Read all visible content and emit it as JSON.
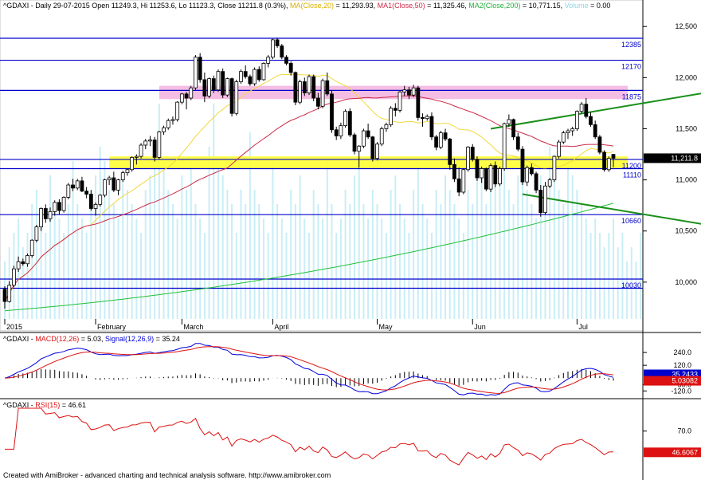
{
  "colors": {
    "background": "#ffffff",
    "up_candle": "#ffffff",
    "down_candle": "#000000",
    "ma20": "#f2d83c",
    "ma50": "#cc2b4a",
    "ma200": "#22c03a",
    "volume": "#c9eef6",
    "hline": "#0000cc",
    "zone_yellow": "#ffff33",
    "zone_pink": "#f4b6e0",
    "channel": "#1a8f1a",
    "macd": "#0000dd",
    "signal": "#dd1111",
    "rsi": "#dd1111",
    "price_badge": "#000000",
    "macd_badge": "#0000cc",
    "signal_badge": "#dd1111",
    "rsi_badge": "#dd1111"
  },
  "header": {
    "symbol_line": "^GDAXI - Daily 29-07-2015 Open 11249.3, Hi 11253.6, Lo 11123.3, Close 11211.8 (0.3%)",
    "ma20_label": "MA(Close,20)",
    "ma20_value": " = 11,293.93, ",
    "ma50_label": "MA1(Close,50)",
    "ma50_value": " = 11,325.46, ",
    "ma200_label": "MA2(Close,200)",
    "ma200_value": " = 10,771.15, ",
    "volume_label": "Volume",
    "volume_value": " = 0.00"
  },
  "macd_header": {
    "prefix": "^GDAXI - ",
    "macd_label": "MACD(12,26)",
    "macd_value": " = 5.03, ",
    "signal_label": "Signal(12,26,9)",
    "signal_value": " = 35.24"
  },
  "rsi_header": {
    "prefix": "^GDAXI - ",
    "rsi_label": "RSI(15)",
    "rsi_value": " = 46.61"
  },
  "footer": "Created with AmiBroker - advanced charting and technical analysis software. http://www.amibroker.com",
  "price_axis_ticks": [
    "12,500",
    "12,000",
    "11,500",
    "11,000",
    "10,500",
    "10,000"
  ],
  "macd_axis_ticks": [
    "240.0",
    "120.0",
    "-60.0",
    "-120.0"
  ],
  "rsi_axis_ticks": [
    "70.0"
  ],
  "badges": {
    "price": "11,211.8",
    "macd": "35.2433",
    "signal": "5.03082",
    "rsi": "46.6067"
  },
  "chart_data": {
    "type": "candlestick",
    "x_axis_labels": [
      "2015",
      "February",
      "March",
      "April",
      "May",
      "Jun",
      "Jul"
    ],
    "ylim": [
      9640,
      12650
    ],
    "horizontal_levels": [
      {
        "value": 12385,
        "label": "12385"
      },
      {
        "value": 12170,
        "label": "12170"
      },
      {
        "value": 11875,
        "label": "11875"
      },
      {
        "value": 11200,
        "label": "11200"
      },
      {
        "value": 11110,
        "label": "11110"
      },
      {
        "value": 10660,
        "label": "10660"
      },
      {
        "value": 10030,
        "label": "10030"
      },
      {
        "value": 9940,
        "label": ""
      }
    ],
    "zones": [
      {
        "name": "yellow",
        "from": 11110,
        "to": 11230
      },
      {
        "name": "pink",
        "from": 11790,
        "to": 11920
      }
    ],
    "channel_lines": [
      {
        "from": {
          "i": 107,
          "v": 11500
        },
        "to": {
          "i": 162,
          "v": 11910
        }
      },
      {
        "from": {
          "i": 114,
          "v": 10860
        },
        "to": {
          "i": 156,
          "v": 10550
        }
      }
    ],
    "last_close": 11211.8,
    "candles": [
      [
        9930,
        9960,
        9740,
        9810
      ],
      [
        9810,
        10010,
        9800,
        9970
      ],
      [
        9970,
        10160,
        9950,
        10130
      ],
      [
        10130,
        10250,
        10100,
        10200
      ],
      [
        10200,
        10230,
        10160,
        10180
      ],
      [
        10180,
        10280,
        10150,
        10260
      ],
      [
        10260,
        10420,
        10240,
        10410
      ],
      [
        10410,
        10560,
        10390,
        10540
      ],
      [
        10540,
        10730,
        10500,
        10720
      ],
      [
        10720,
        10760,
        10580,
        10620
      ],
      [
        10620,
        10730,
        10590,
        10690
      ],
      [
        10690,
        10800,
        10650,
        10780
      ],
      [
        10780,
        10810,
        10660,
        10700
      ],
      [
        10700,
        10840,
        10680,
        10830
      ],
      [
        10830,
        10970,
        10810,
        10950
      ],
      [
        10950,
        11010,
        10890,
        10920
      ],
      [
        10920,
        11010,
        10900,
        10990
      ],
      [
        10990,
        11030,
        10880,
        10890
      ],
      [
        10890,
        10930,
        10820,
        10860
      ],
      [
        10860,
        10900,
        10700,
        10720
      ],
      [
        10720,
        10780,
        10650,
        10760
      ],
      [
        10760,
        10860,
        10740,
        10850
      ],
      [
        10850,
        11010,
        10830,
        11000
      ],
      [
        11000,
        11040,
        10950,
        11020
      ],
      [
        11020,
        11080,
        10880,
        10900
      ],
      [
        10900,
        11010,
        10850,
        11000
      ],
      [
        11000,
        11090,
        10980,
        11070
      ],
      [
        11070,
        11110,
        11040,
        11100
      ],
      [
        11100,
        11230,
        11080,
        11220
      ],
      [
        11220,
        11250,
        11150,
        11230
      ],
      [
        11230,
        11360,
        11210,
        11340
      ],
      [
        11340,
        11400,
        11300,
        11380
      ],
      [
        11380,
        11430,
        11330,
        11390
      ],
      [
        11390,
        11420,
        11180,
        11220
      ],
      [
        11220,
        11480,
        11200,
        11470
      ],
      [
        11470,
        11530,
        11440,
        11510
      ],
      [
        11510,
        11600,
        11490,
        11580
      ],
      [
        11580,
        11620,
        11540,
        11590
      ],
      [
        11590,
        11770,
        11570,
        11760
      ],
      [
        11760,
        11850,
        11740,
        11840
      ],
      [
        11840,
        11860,
        11690,
        11800
      ],
      [
        11800,
        11920,
        11780,
        11900
      ],
      [
        11900,
        12220,
        11880,
        12200
      ],
      [
        12200,
        12240,
        11950,
        11980
      ],
      [
        11980,
        12050,
        11760,
        11820
      ],
      [
        11820,
        12000,
        11800,
        11990
      ],
      [
        11990,
        12020,
        11850,
        11880
      ],
      [
        11880,
        12080,
        11860,
        12060
      ],
      [
        12060,
        12090,
        11800,
        11830
      ],
      [
        11830,
        12000,
        11810,
        11990
      ],
      [
        11990,
        12000,
        11620,
        11650
      ],
      [
        11650,
        11980,
        11630,
        11960
      ],
      [
        11960,
        12080,
        11940,
        12060
      ],
      [
        12060,
        12120,
        11990,
        12010
      ],
      [
        12010,
        12030,
        11920,
        11940
      ],
      [
        11940,
        12100,
        11920,
        12080
      ],
      [
        12080,
        12110,
        11960,
        11980
      ],
      [
        11980,
        12150,
        11970,
        12140
      ],
      [
        12140,
        12220,
        12100,
        12200
      ],
      [
        12200,
        12380,
        12180,
        12370
      ],
      [
        12370,
        12390,
        12290,
        12310
      ],
      [
        12310,
        12330,
        12180,
        12200
      ],
      [
        12200,
        12220,
        12120,
        12140
      ],
      [
        12140,
        12160,
        12020,
        12050
      ],
      [
        12050,
        12060,
        11730,
        11760
      ],
      [
        11760,
        11980,
        11740,
        11960
      ],
      [
        11960,
        12000,
        11820,
        11850
      ],
      [
        11850,
        12030,
        11830,
        12010
      ],
      [
        12010,
        12030,
        11770,
        11800
      ],
      [
        11800,
        11850,
        11690,
        11720
      ],
      [
        11720,
        11990,
        11700,
        11970
      ],
      [
        11970,
        12050,
        11820,
        11840
      ],
      [
        11840,
        11880,
        11460,
        11490
      ],
      [
        11490,
        11520,
        11390,
        11430
      ],
      [
        11430,
        11560,
        11400,
        11530
      ],
      [
        11530,
        11690,
        11510,
        11670
      ],
      [
        11670,
        11700,
        11420,
        11440
      ],
      [
        11440,
        11460,
        11250,
        11280
      ],
      [
        11280,
        11340,
        11120,
        11330
      ],
      [
        11330,
        11500,
        11310,
        11480
      ],
      [
        11480,
        11550,
        11400,
        11420
      ],
      [
        11420,
        11430,
        11180,
        11210
      ],
      [
        11210,
        11370,
        11190,
        11350
      ],
      [
        11350,
        11520,
        11330,
        11500
      ],
      [
        11500,
        11560,
        11470,
        11540
      ],
      [
        11540,
        11720,
        11520,
        11700
      ],
      [
        11700,
        11750,
        11620,
        11680
      ],
      [
        11680,
        11870,
        11660,
        11860
      ],
      [
        11860,
        11920,
        11820,
        11880
      ],
      [
        11880,
        11910,
        11790,
        11830
      ],
      [
        11830,
        11930,
        11810,
        11900
      ],
      [
        11900,
        11920,
        11580,
        11610
      ],
      [
        11610,
        11650,
        11520,
        11600
      ],
      [
        11600,
        11640,
        11580,
        11620
      ],
      [
        11620,
        11660,
        11390,
        11420
      ],
      [
        11420,
        11440,
        11290,
        11320
      ],
      [
        11320,
        11480,
        11300,
        11460
      ],
      [
        11460,
        11500,
        11380,
        11400
      ],
      [
        11400,
        11410,
        11100,
        11150
      ],
      [
        11150,
        11210,
        10980,
        11010
      ],
      [
        11010,
        11120,
        10840,
        10880
      ],
      [
        10880,
        11110,
        10860,
        11100
      ],
      [
        11100,
        11330,
        11080,
        11320
      ],
      [
        11320,
        11350,
        11180,
        11200
      ],
      [
        11200,
        11230,
        10990,
        11020
      ],
      [
        11020,
        11130,
        10970,
        11110
      ],
      [
        11110,
        11120,
        10890,
        10910
      ],
      [
        10910,
        11160,
        10880,
        11140
      ],
      [
        11140,
        11180,
        10930,
        10960
      ],
      [
        10960,
        11130,
        10940,
        11110
      ],
      [
        11110,
        11560,
        11090,
        11550
      ],
      [
        11550,
        11640,
        11520,
        11590
      ],
      [
        11590,
        11600,
        11390,
        11420
      ],
      [
        11420,
        11460,
        11280,
        11300
      ],
      [
        11300,
        11330,
        10950,
        10980
      ],
      [
        10980,
        11140,
        10940,
        11120
      ],
      [
        11120,
        11160,
        11040,
        11060
      ],
      [
        11060,
        11080,
        10870,
        10900
      ],
      [
        10900,
        10950,
        10640,
        10680
      ],
      [
        10680,
        10980,
        10660,
        10940
      ],
      [
        10940,
        11020,
        10920,
        11000
      ],
      [
        11000,
        11240,
        10980,
        11230
      ],
      [
        11230,
        11390,
        11210,
        11370
      ],
      [
        11370,
        11480,
        11350,
        11460
      ],
      [
        11460,
        11500,
        11400,
        11480
      ],
      [
        11480,
        11520,
        11430,
        11500
      ],
      [
        11500,
        11680,
        11480,
        11670
      ],
      [
        11670,
        11760,
        11650,
        11740
      ],
      [
        11740,
        11800,
        11600,
        11620
      ],
      [
        11620,
        11660,
        11520,
        11540
      ],
      [
        11540,
        11580,
        11400,
        11420
      ],
      [
        11420,
        11440,
        11250,
        11270
      ],
      [
        11270,
        11290,
        11080,
        11100
      ],
      [
        11100,
        11230,
        11080,
        11210
      ],
      [
        11249.3,
        11253.6,
        11123.3,
        11211.8
      ]
    ],
    "volume": [
      0.2,
      0.25,
      0.3,
      0.35,
      0.25,
      0.3,
      0.4,
      0.45,
      0.35,
      0.3,
      0.5,
      0.4,
      0.35,
      0.3,
      0.4,
      0.55,
      0.4,
      0.35,
      0.3,
      0.45,
      0.5,
      0.6,
      0.55,
      0.45,
      0.4,
      0.35,
      0.5,
      0.45,
      0.4,
      0.35,
      0.3,
      0.45,
      0.5,
      0.6,
      0.75,
      0.55,
      0.45,
      0.4,
      0.35,
      0.5,
      0.45,
      0.55,
      0.4,
      0.35,
      0.3,
      0.6,
      0.75,
      0.55,
      0.5,
      0.45,
      0.4,
      0.3,
      0.45,
      0.4,
      0.65,
      0.45,
      0.4,
      0.35,
      0.3,
      0.55,
      0.4,
      0.35,
      0.3,
      0.45,
      0.4,
      0.5,
      0.35,
      0.3,
      0.45,
      0.4,
      0.35,
      0.55,
      0.4,
      0.3,
      0.35,
      0.45,
      0.4,
      0.5,
      0.55,
      0.4,
      0.35,
      0.45,
      0.4,
      0.35,
      0.3,
      0.45,
      0.5,
      0.4,
      0.35,
      0.3,
      0.45,
      0.55,
      0.4,
      0.35,
      0.3,
      0.45,
      0.4,
      0.5,
      0.45,
      0.4,
      0.35,
      0.3,
      0.45,
      0.4,
      0.5,
      0.55,
      0.4,
      0.45,
      0.5,
      0.55,
      0.6,
      0.45,
      0.4,
      0.5,
      0.55,
      0.45,
      0.4,
      0.35,
      0.5,
      0.45,
      0.6,
      0.5,
      0.45,
      0.4,
      0.55,
      0.5,
      0.45,
      0.4,
      0.35,
      0.3,
      0.35,
      0.3,
      0.25,
      0.3,
      0.35,
      0.25,
      0.3,
      0.2,
      0.25,
      0.2,
      0.3
    ],
    "ma200_start": 9720,
    "ma200_end": 10771.15,
    "macd_ylim": [
      -170,
      330
    ],
    "rsi_ylim": [
      25,
      95
    ]
  }
}
